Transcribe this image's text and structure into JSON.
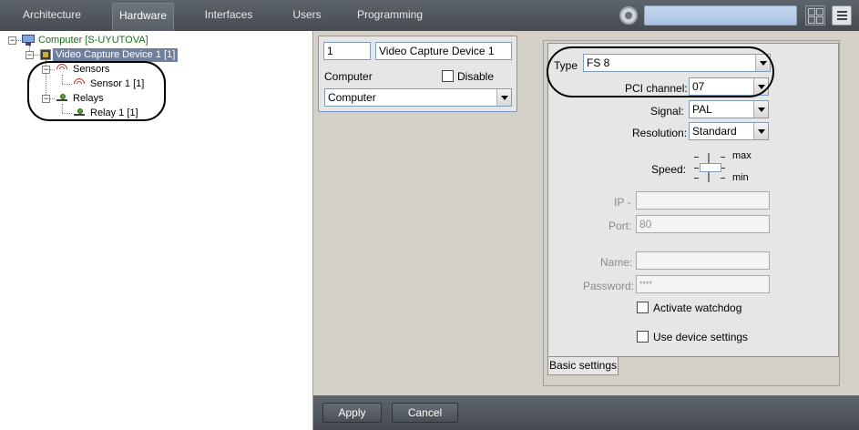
{
  "tabs": [
    {
      "label": "Architecture",
      "active": false
    },
    {
      "label": "Hardware",
      "active": true
    },
    {
      "label": "Interfaces",
      "active": false
    },
    {
      "label": "Users",
      "active": false
    },
    {
      "label": "Programming",
      "active": false
    }
  ],
  "toolbar": {
    "search_value": "",
    "icons": [
      "gear-icon",
      "layout-grid-icon",
      "menu-icon"
    ]
  },
  "tree": {
    "computer": "Computer [S-UYUTOVA]",
    "video_capture": "Video Capture Device 1 [1]",
    "sensors": "Sensors",
    "sensor1": "Sensor 1 [1]",
    "relays": "Relays",
    "relay1": "Relay 1 [1]"
  },
  "device": {
    "number": "1",
    "name": "Video Capture Device 1",
    "computer_label": "Computer",
    "disable_label": "Disable",
    "disable_checked": false,
    "computer_value": "Computer"
  },
  "settings": {
    "type_label": "Type",
    "type_value": "FS 8",
    "pci_label": "PCI channel:",
    "pci_value": "07",
    "signal_label": "Signal:",
    "signal_value": "PAL",
    "resolution_label": "Resolution:",
    "resolution_value": "Standard",
    "speed_label": "Speed:",
    "speed_max": "max",
    "speed_min": "min",
    "ip_label": "IP -",
    "ip_value": "",
    "port_label": "Port:",
    "port_value": "80",
    "name_label": "Name:",
    "name_value": "",
    "password_label": "Password:",
    "password_value": "****",
    "watchdog_label": "Activate watchdog",
    "device_settings_label": "Use device settings",
    "tab_label": "Basic settings"
  },
  "footer": {
    "apply": "Apply",
    "cancel": "Cancel"
  },
  "colors": {
    "topbar": "#4f555b",
    "selection": "#6f7f9c",
    "tree_text_green": "#1e6b1e"
  }
}
